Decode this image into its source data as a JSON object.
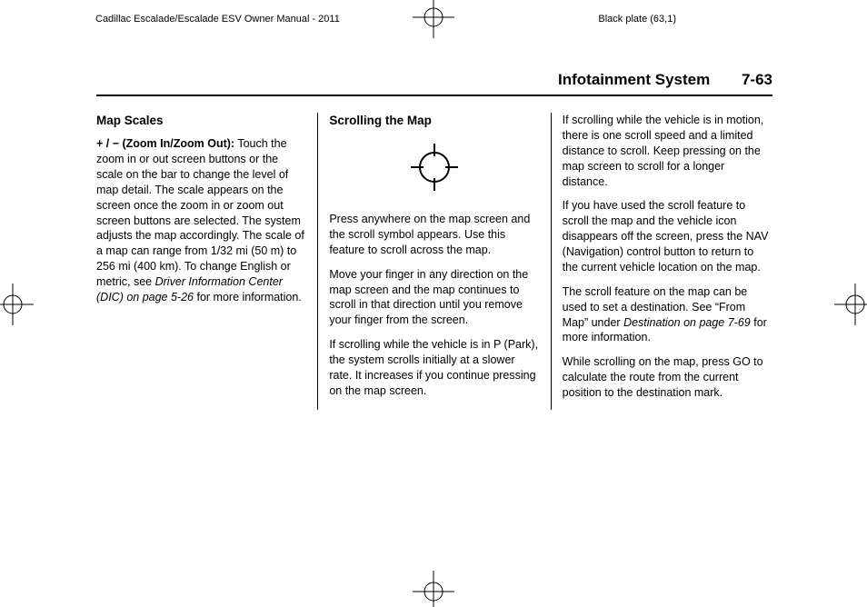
{
  "meta": {
    "title_left": "Cadillac Escalade/Escalade ESV Owner Manual - 2011",
    "title_right": "Black plate (63,1)"
  },
  "header": {
    "section": "Infotainment System",
    "page": "7-63"
  },
  "col1": {
    "heading": "Map Scales",
    "lead_bold": "+ / − (Zoom In/Zoom Out):",
    "lead_rest": " Touch the zoom in or out screen buttons or the scale on the bar to change the level of map detail. The scale appears on the screen once the zoom in or zoom out screen buttons are selected. The system adjusts the map accordingly. The scale of a map can range from 1/32 mi (50 m) to 256 mi (400 km). To change English or metric, see ",
    "lead_ital": "Driver Information Center (DIC) on page 5-26",
    "lead_tail": " for more information."
  },
  "col2": {
    "heading": "Scrolling the Map",
    "p1": "Press anywhere on the map screen and the scroll symbol appears. Use this feature to scroll across the map.",
    "p2": "Move your finger in any direction on the map screen and the map continues to scroll in that direction until you remove your finger from the screen.",
    "p3": "If scrolling while the vehicle is in P (Park), the system scrolls initially at a slower rate. It increases if you continue pressing on the map screen."
  },
  "col3": {
    "p1": "If scrolling while the vehicle is in motion, there is one scroll speed and a limited distance to scroll. Keep pressing on the map screen to scroll for a longer distance.",
    "p2": "If you have used the scroll feature to scroll the map and the vehicle icon disappears off the screen, press the NAV (Navigation) control button to return to the current vehicle location on the map.",
    "p3a": "The scroll feature on the map can be used to set a destination. See “From Map” under ",
    "p3_ital": "Destination on page 7-69",
    "p3b": " for more information.",
    "p4": "While scrolling on the map, press GO to calculate the route from the current position to the destination mark."
  }
}
